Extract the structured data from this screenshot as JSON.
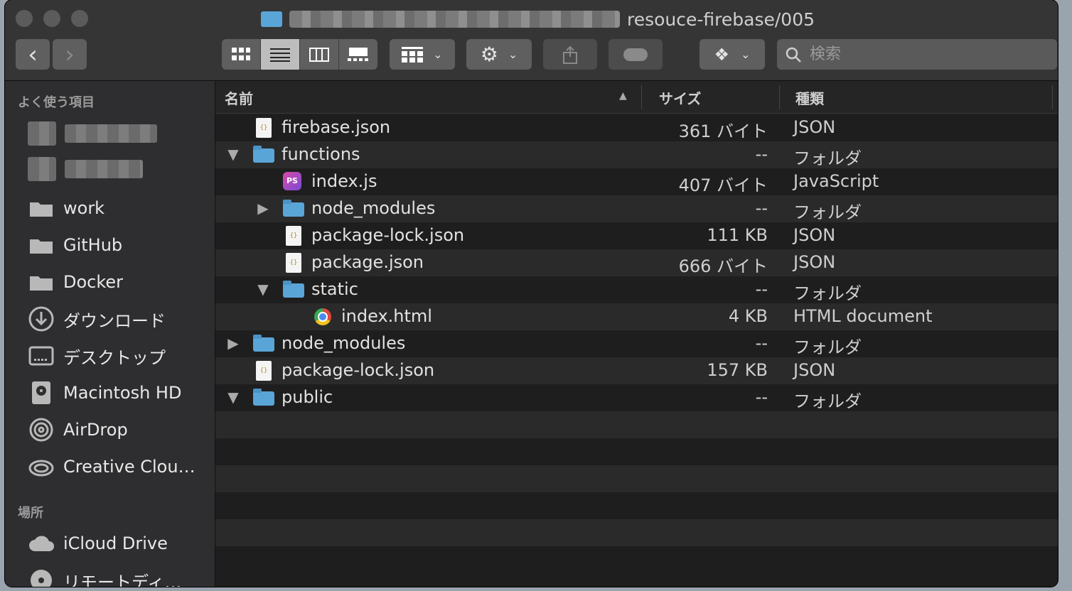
{
  "window": {
    "title_path": "resouce-firebase/005"
  },
  "toolbar": {
    "back_label": "‹",
    "forward_label": "›",
    "search_placeholder": "検索"
  },
  "sidebar": {
    "section_favorites": "よく使う項目",
    "section_locations": "場所",
    "favorites": [
      {
        "label": "work",
        "icon": "folder-icon"
      },
      {
        "label": "GitHub",
        "icon": "folder-icon"
      },
      {
        "label": "Docker",
        "icon": "folder-icon"
      },
      {
        "label": "ダウンロード",
        "icon": "download-icon"
      },
      {
        "label": "デスクトップ",
        "icon": "desktop-icon"
      },
      {
        "label": "Macintosh HD",
        "icon": "disk-icon"
      },
      {
        "label": "AirDrop",
        "icon": "airdrop-icon"
      },
      {
        "label": "Creative Clou…",
        "icon": "creative-cloud-icon"
      }
    ],
    "locations": [
      {
        "label": "iCloud Drive",
        "icon": "cloud-icon"
      },
      {
        "label": "リモートディ…",
        "icon": "remote-disc-icon"
      }
    ]
  },
  "columns": {
    "name": "名前",
    "size": "サイズ",
    "kind": "種類"
  },
  "files": [
    {
      "name": "firebase.json",
      "size": "361 バイト",
      "kind": "JSON",
      "type": "json",
      "level": 0,
      "disclosure": ""
    },
    {
      "name": "functions",
      "size": "--",
      "kind": "フォルダ",
      "type": "folder",
      "level": 0,
      "disclosure": "▼"
    },
    {
      "name": "index.js",
      "size": "407 バイト",
      "kind": "JavaScript",
      "type": "ps",
      "level": 1,
      "disclosure": ""
    },
    {
      "name": "node_modules",
      "size": "--",
      "kind": "フォルダ",
      "type": "folder",
      "level": 1,
      "disclosure": "▶"
    },
    {
      "name": "package-lock.json",
      "size": "111 KB",
      "kind": "JSON",
      "type": "json",
      "level": 1,
      "disclosure": ""
    },
    {
      "name": "package.json",
      "size": "666 バイト",
      "kind": "JSON",
      "type": "json",
      "level": 1,
      "disclosure": ""
    },
    {
      "name": "static",
      "size": "--",
      "kind": "フォルダ",
      "type": "folder",
      "level": 1,
      "disclosure": "▼"
    },
    {
      "name": "index.html",
      "size": "4 KB",
      "kind": "HTML document",
      "type": "html",
      "level": 2,
      "disclosure": ""
    },
    {
      "name": "node_modules",
      "size": "--",
      "kind": "フォルダ",
      "type": "folder",
      "level": 0,
      "disclosure": "▶"
    },
    {
      "name": "package-lock.json",
      "size": "157 KB",
      "kind": "JSON",
      "type": "json",
      "level": 0,
      "disclosure": ""
    },
    {
      "name": "public",
      "size": "--",
      "kind": "フォルダ",
      "type": "folder",
      "level": 0,
      "disclosure": "▼"
    }
  ],
  "json_icon_glyph": "{}",
  "ps_icon_glyph": "PS"
}
